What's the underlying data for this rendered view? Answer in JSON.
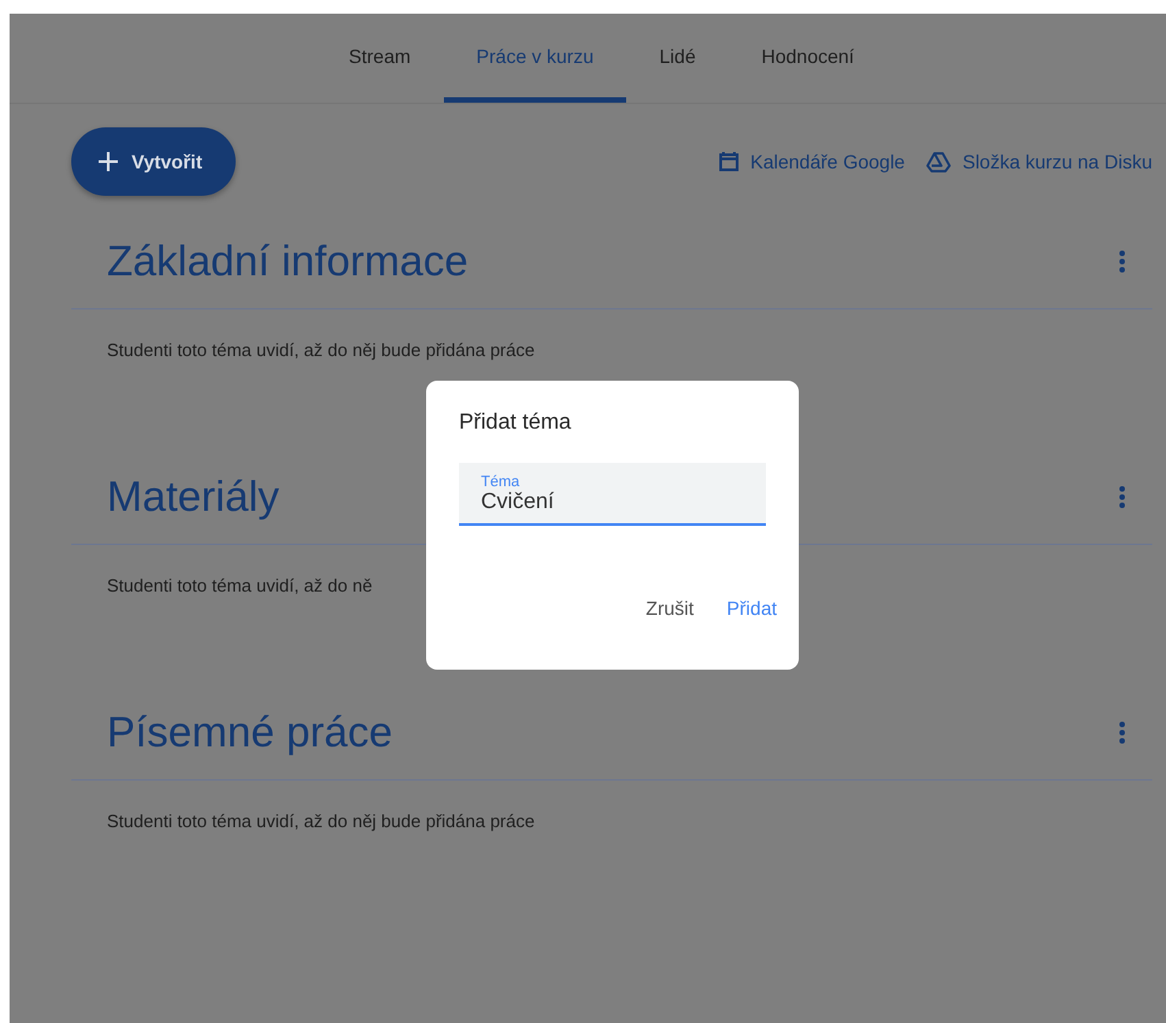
{
  "tabs": [
    {
      "label": "Stream",
      "selected": false
    },
    {
      "label": "Práce v kurzu",
      "selected": true
    },
    {
      "label": "Lidé",
      "selected": false
    },
    {
      "label": "Hodnocení",
      "selected": false
    }
  ],
  "toolbar": {
    "create_button": "Vytvořit",
    "links": [
      {
        "kind": "calendar",
        "label": "Kalendáře Google"
      },
      {
        "kind": "drive",
        "label": "Složka kurzu na Disku"
      }
    ]
  },
  "topics": [
    {
      "title": "Základní informace",
      "note": "Studenti toto téma uvidí, až do něj bude přidána práce"
    },
    {
      "title": "Materiály",
      "note": "Studenti toto téma uvidí, až do ně"
    },
    {
      "title": "Písemné práce",
      "note": "Studenti toto téma uvidí, až do něj bude přidána práce"
    }
  ],
  "dialog": {
    "title": "Přidat téma",
    "field": {
      "label": "Téma",
      "value": "Cvičení"
    },
    "buttons": [
      {
        "label": "Zrušit",
        "kind": "cancel"
      },
      {
        "label": "Přidat",
        "kind": "confirm"
      }
    ]
  }
}
